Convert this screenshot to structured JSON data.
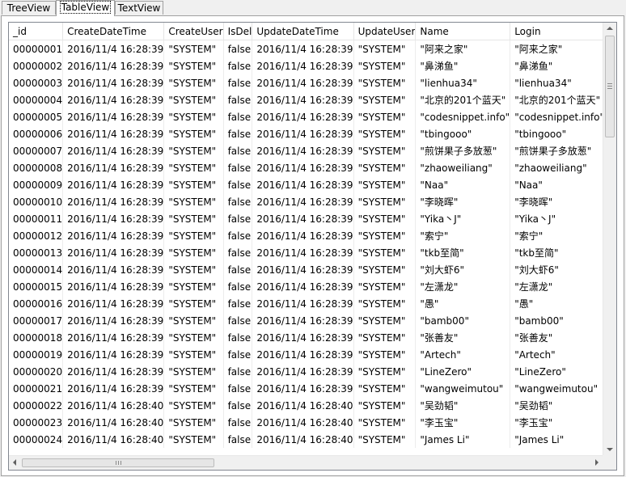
{
  "tabs": [
    {
      "label": "TreeView",
      "active": false
    },
    {
      "label": "TableView",
      "active": true
    },
    {
      "label": "TextView",
      "active": false
    }
  ],
  "table": {
    "columns": [
      "_id",
      "CreateDateTime",
      "CreateUser",
      "IsDel",
      "UpdateDateTime",
      "UpdateUser",
      "Name",
      "Login"
    ],
    "rows": [
      [
        "00000001",
        "2016/11/4 16:28:39",
        "\"SYSTEM\"",
        "false",
        "2016/11/4 16:28:39",
        "\"SYSTEM\"",
        "\"阿来之家\"",
        "\"阿来之家\""
      ],
      [
        "00000002",
        "2016/11/4 16:28:39",
        "\"SYSTEM\"",
        "false",
        "2016/11/4 16:28:39",
        "\"SYSTEM\"",
        "\"鼻涕鱼\"",
        "\"鼻涕鱼\""
      ],
      [
        "00000003",
        "2016/11/4 16:28:39",
        "\"SYSTEM\"",
        "false",
        "2016/11/4 16:28:39",
        "\"SYSTEM\"",
        "\"lienhua34\"",
        "\"lienhua34\""
      ],
      [
        "00000004",
        "2016/11/4 16:28:39",
        "\"SYSTEM\"",
        "false",
        "2016/11/4 16:28:39",
        "\"SYSTEM\"",
        "\"北京的201个蓝天\"",
        "\"北京的201个蓝天\""
      ],
      [
        "00000005",
        "2016/11/4 16:28:39",
        "\"SYSTEM\"",
        "false",
        "2016/11/4 16:28:39",
        "\"SYSTEM\"",
        "\"codesnippet.info\"",
        "\"codesnippet.info\""
      ],
      [
        "00000006",
        "2016/11/4 16:28:39",
        "\"SYSTEM\"",
        "false",
        "2016/11/4 16:28:39",
        "\"SYSTEM\"",
        "\"tbingooo\"",
        "\"tbingooo\""
      ],
      [
        "00000007",
        "2016/11/4 16:28:39",
        "\"SYSTEM\"",
        "false",
        "2016/11/4 16:28:39",
        "\"SYSTEM\"",
        "\"煎饼果子多放葱\"",
        "\"煎饼果子多放葱\""
      ],
      [
        "00000008",
        "2016/11/4 16:28:39",
        "\"SYSTEM\"",
        "false",
        "2016/11/4 16:28:39",
        "\"SYSTEM\"",
        "\"zhaoweiliang\"",
        "\"zhaoweiliang\""
      ],
      [
        "00000009",
        "2016/11/4 16:28:39",
        "\"SYSTEM\"",
        "false",
        "2016/11/4 16:28:39",
        "\"SYSTEM\"",
        "\"Naa\"",
        "\"Naa\""
      ],
      [
        "00000010",
        "2016/11/4 16:28:39",
        "\"SYSTEM\"",
        "false",
        "2016/11/4 16:28:39",
        "\"SYSTEM\"",
        "\"李晓晖\"",
        "\"李晓晖\""
      ],
      [
        "00000011",
        "2016/11/4 16:28:39",
        "\"SYSTEM\"",
        "false",
        "2016/11/4 16:28:39",
        "\"SYSTEM\"",
        "\"Yika丶J\"",
        "\"Yika丶J\""
      ],
      [
        "00000012",
        "2016/11/4 16:28:39",
        "\"SYSTEM\"",
        "false",
        "2016/11/4 16:28:39",
        "\"SYSTEM\"",
        "\"索宁\"",
        "\"索宁\""
      ],
      [
        "00000013",
        "2016/11/4 16:28:39",
        "\"SYSTEM\"",
        "false",
        "2016/11/4 16:28:39",
        "\"SYSTEM\"",
        "\"tkb至简\"",
        "\"tkb至简\""
      ],
      [
        "00000014",
        "2016/11/4 16:28:39",
        "\"SYSTEM\"",
        "false",
        "2016/11/4 16:28:39",
        "\"SYSTEM\"",
        "\"刘大虾6\"",
        "\"刘大虾6\""
      ],
      [
        "00000015",
        "2016/11/4 16:28:39",
        "\"SYSTEM\"",
        "false",
        "2016/11/4 16:28:39",
        "\"SYSTEM\"",
        "\"左潇龙\"",
        "\"左潇龙\""
      ],
      [
        "00000016",
        "2016/11/4 16:28:39",
        "\"SYSTEM\"",
        "false",
        "2016/11/4 16:28:39",
        "\"SYSTEM\"",
        "\"愚\"",
        "\"愚\""
      ],
      [
        "00000017",
        "2016/11/4 16:28:39",
        "\"SYSTEM\"",
        "false",
        "2016/11/4 16:28:39",
        "\"SYSTEM\"",
        "\"bamb00\"",
        "\"bamb00\""
      ],
      [
        "00000018",
        "2016/11/4 16:28:39",
        "\"SYSTEM\"",
        "false",
        "2016/11/4 16:28:39",
        "\"SYSTEM\"",
        "\"张善友\"",
        "\"张善友\""
      ],
      [
        "00000019",
        "2016/11/4 16:28:39",
        "\"SYSTEM\"",
        "false",
        "2016/11/4 16:28:39",
        "\"SYSTEM\"",
        "\"Artech\"",
        "\"Artech\""
      ],
      [
        "00000020",
        "2016/11/4 16:28:39",
        "\"SYSTEM\"",
        "false",
        "2016/11/4 16:28:39",
        "\"SYSTEM\"",
        "\"LineZero\"",
        "\"LineZero\""
      ],
      [
        "00000021",
        "2016/11/4 16:28:39",
        "\"SYSTEM\"",
        "false",
        "2016/11/4 16:28:39",
        "\"SYSTEM\"",
        "\"wangweimutou\"",
        "\"wangweimutou\""
      ],
      [
        "00000022",
        "2016/11/4 16:28:40",
        "\"SYSTEM\"",
        "false",
        "2016/11/4 16:28:40",
        "\"SYSTEM\"",
        "\"吴劲韬\"",
        "\"吴劲韬\""
      ],
      [
        "00000023",
        "2016/11/4 16:28:40",
        "\"SYSTEM\"",
        "false",
        "2016/11/4 16:28:40",
        "\"SYSTEM\"",
        "\"李玉宝\"",
        "\"李玉宝\""
      ],
      [
        "00000024",
        "2016/11/4 16:28:40",
        "\"SYSTEM\"",
        "false",
        "2016/11/4 16:28:40",
        "\"SYSTEM\"",
        "\"James Li\"",
        "\"James Li\""
      ]
    ]
  }
}
